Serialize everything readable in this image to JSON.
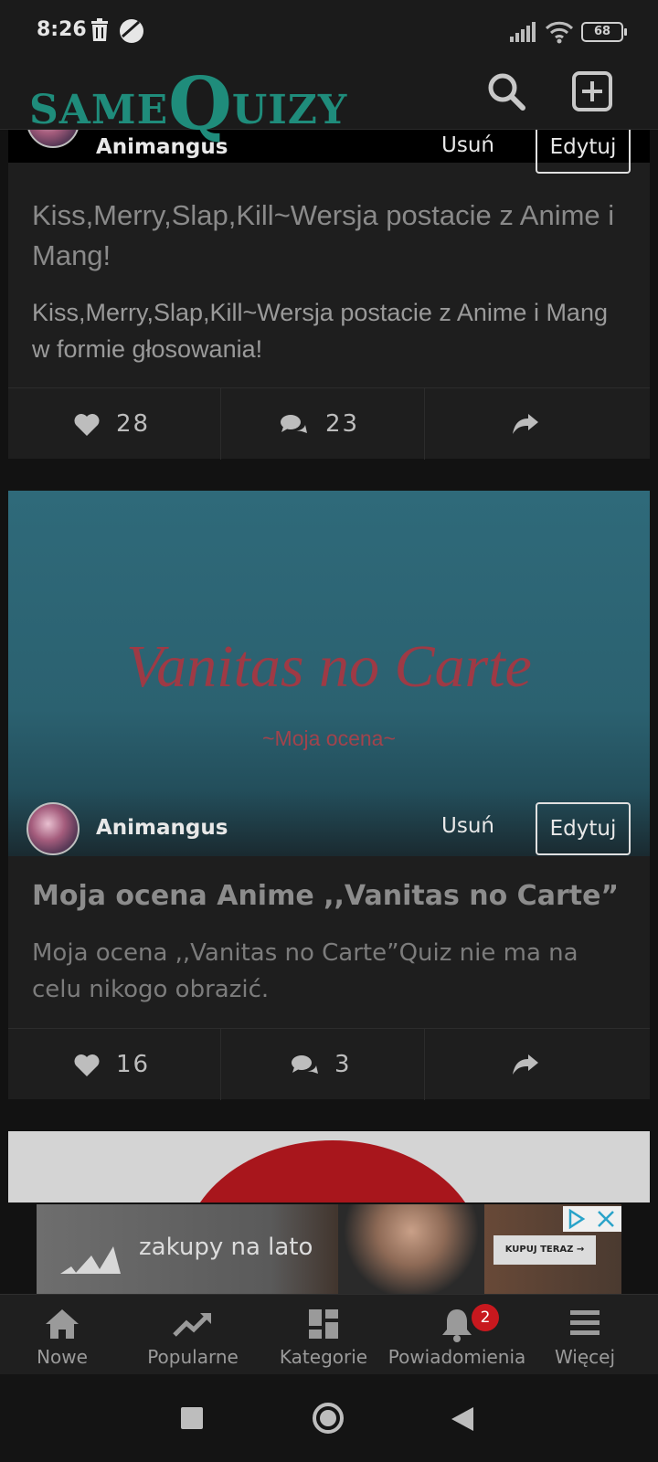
{
  "status_bar": {
    "time": "8:26",
    "battery": "68"
  },
  "header": {
    "logo_part1": "same",
    "logo_part2": "Q",
    "logo_part3": "uizy",
    "icons": [
      "search-icon",
      "plus-square-icon"
    ]
  },
  "cards": [
    {
      "author": "Animangus",
      "delete_label": "Usuń",
      "edit_label": "Edytuj",
      "title": "Kiss,Merry,Slap,Kill~Wersja postacie z Anime i Mang!",
      "description": "Kiss,Merry,Slap,Kill~Wersja postacie z Anime i Mang w formie głosowania!",
      "likes": "28",
      "comments": "23"
    },
    {
      "banner_title": "Vanitas no Carte",
      "banner_subtitle": "~Moja ocena~",
      "author": "Animangus",
      "delete_label": "Usuń",
      "edit_label": "Edytuj",
      "title": "Moja ocena Anime ,,Vanitas no Carte”",
      "description": "Moja ocena ,,Vanitas no Carte”Quiz nie ma na celu nikogo obrazić.",
      "likes": "16",
      "comments": "3"
    }
  ],
  "ad": {
    "text": "zakupy na lato",
    "cta": "KUPUJ TERAZ →"
  },
  "bottom_nav": [
    {
      "label": "Nowe",
      "icon": "home-icon"
    },
    {
      "label": "Popularne",
      "icon": "trending-icon"
    },
    {
      "label": "Kategorie",
      "icon": "grid-icon"
    },
    {
      "label": "Powiadomienia",
      "icon": "bell-icon",
      "badge": "2"
    },
    {
      "label": "Więcej",
      "icon": "menu-icon"
    }
  ],
  "colors": {
    "brand": "#1f8c7b",
    "background": "#121212",
    "card": "#1e1e1e",
    "badge": "#c8181e"
  }
}
